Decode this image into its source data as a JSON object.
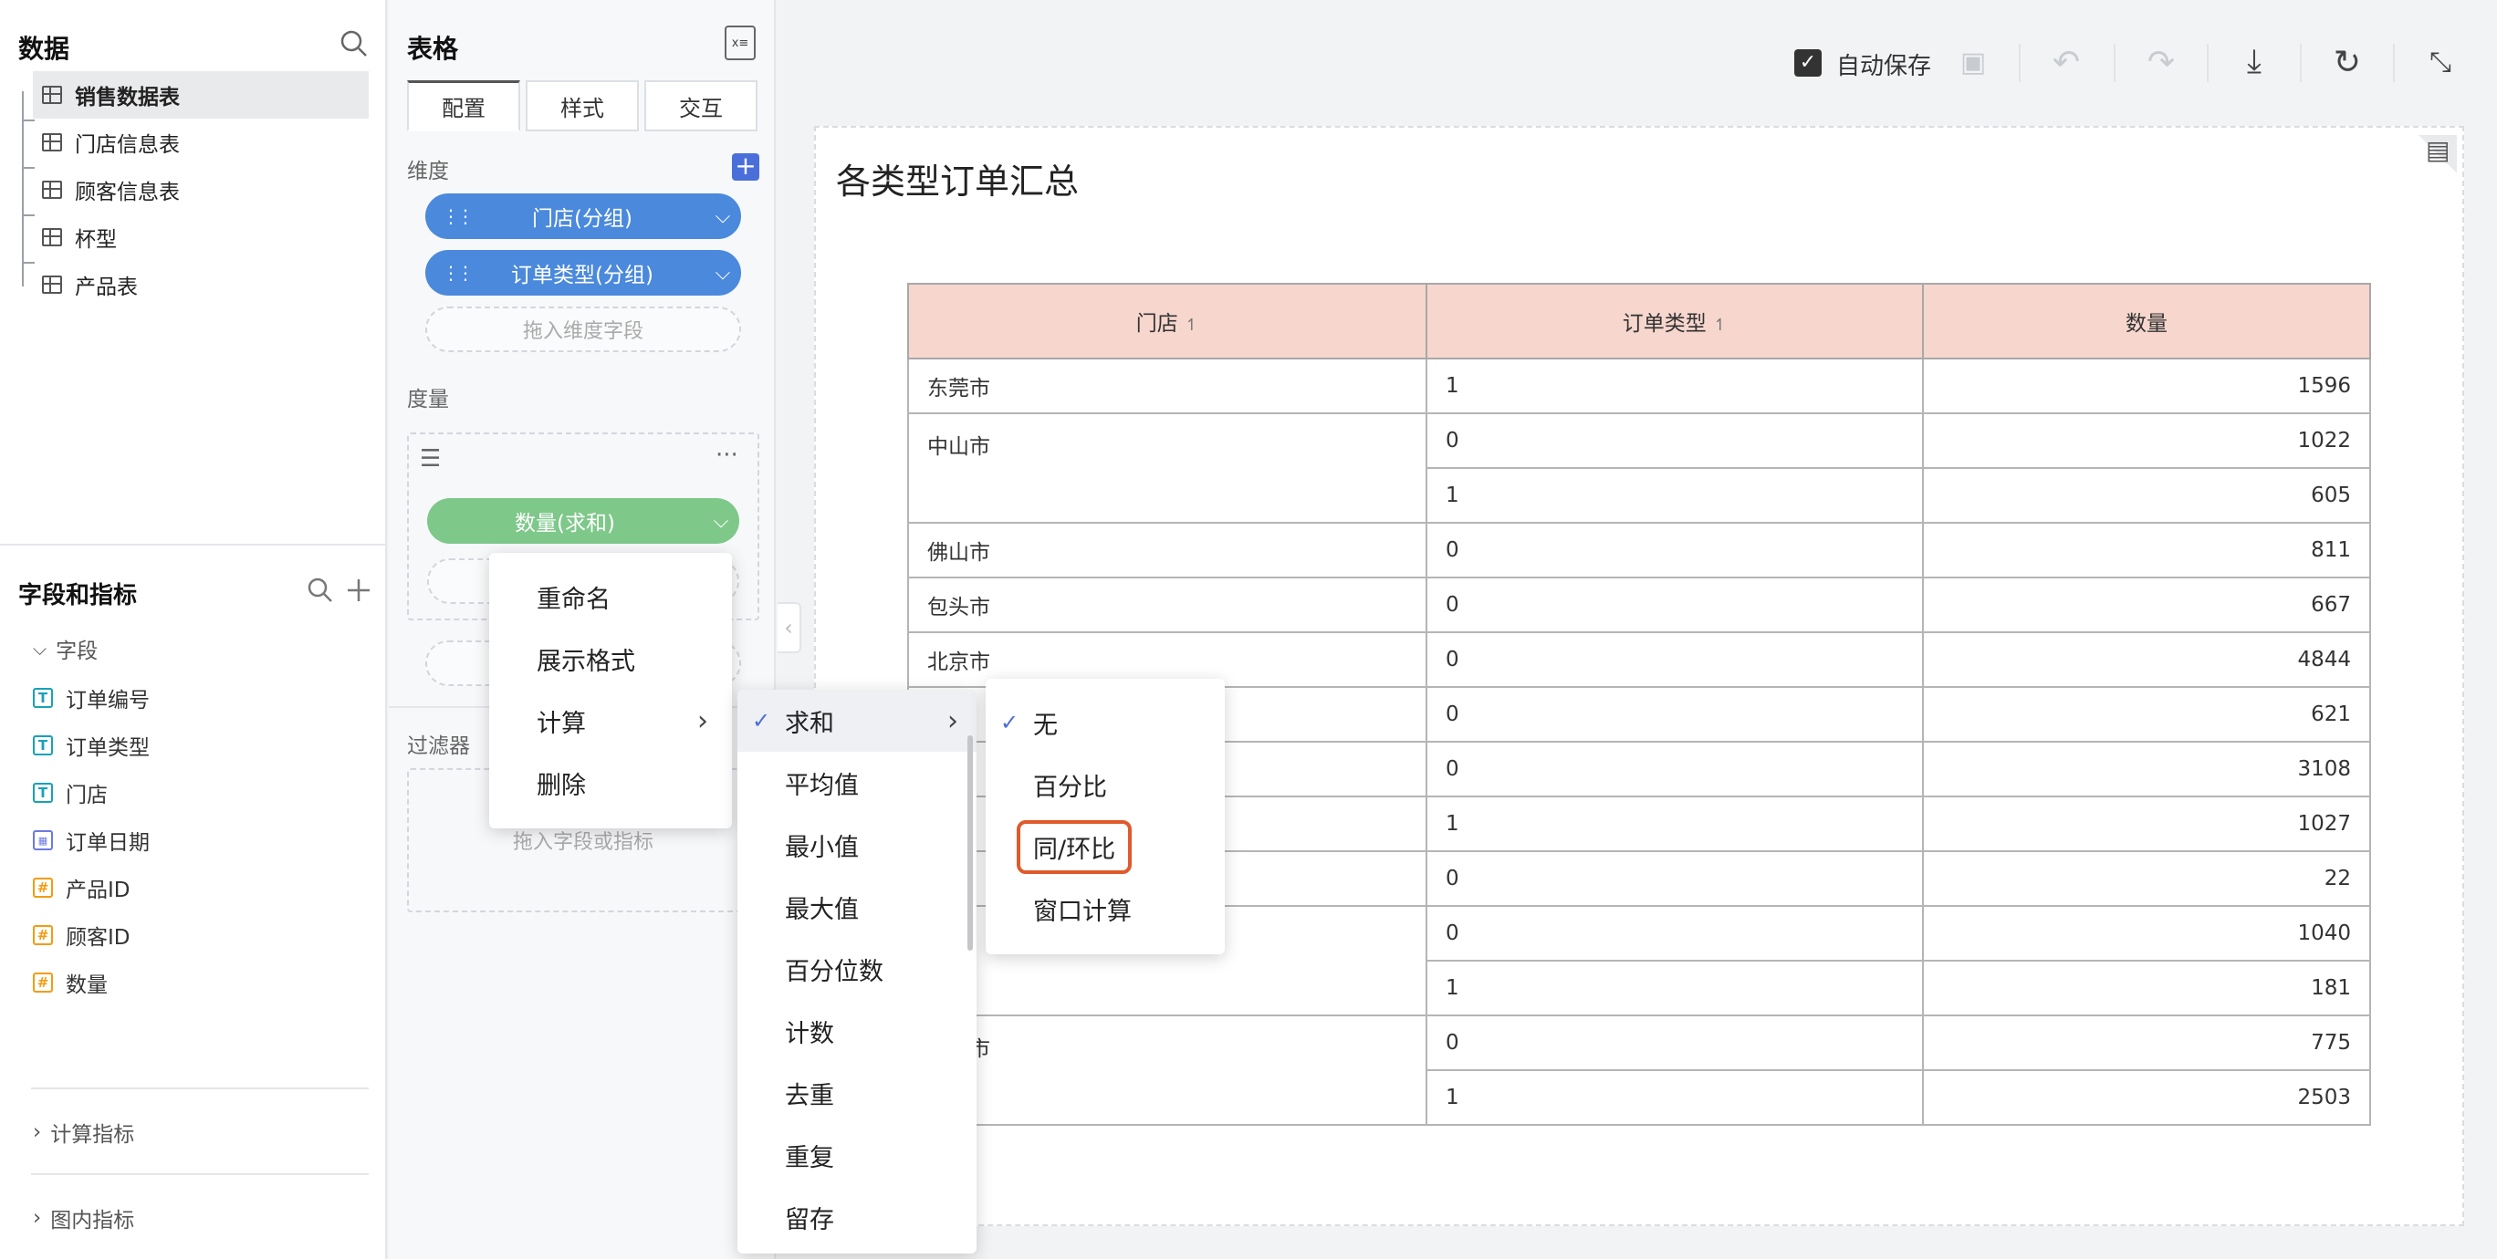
{
  "left_panel": {
    "title": "数据",
    "tables": [
      "销售数据表",
      "门店信息表",
      "顾客信息表",
      "杯型",
      "产品表"
    ],
    "fields_title": "字段和指标",
    "fields_group": "字段",
    "fields": [
      {
        "name": "订单编号",
        "type": "T"
      },
      {
        "name": "订单类型",
        "type": "T"
      },
      {
        "name": "门店",
        "type": "T"
      },
      {
        "name": "订单日期",
        "type": "D"
      },
      {
        "name": "产品ID",
        "type": "#"
      },
      {
        "name": "顾客ID",
        "type": "#"
      },
      {
        "name": "数量",
        "type": "#"
      }
    ],
    "calc_metrics": "计算指标",
    "inner_metrics": "图内指标"
  },
  "config_panel": {
    "title": "表格",
    "tabs": [
      "配置",
      "样式",
      "交互"
    ],
    "dimension_label": "维度",
    "dimension_pills": [
      "门店(分组)",
      "订单类型(分组)"
    ],
    "dimension_drop": "拖入维度字段",
    "measure_label": "度量",
    "measure_pill": "数量(求和)",
    "filter_label": "过滤器",
    "filter_drop": "拖入字段或指标"
  },
  "toolbar": {
    "autosave_label": "自动保存",
    "autosave_checked": true
  },
  "canvas": {
    "chart_title": "各类型订单汇总",
    "columns": [
      "门店",
      "订单类型",
      "数量"
    ],
    "rows": [
      {
        "store": "东莞市",
        "type": "1",
        "qty": "1596"
      },
      {
        "store": "中山市",
        "type": "0",
        "qty": "1022"
      },
      {
        "store": "",
        "type": "1",
        "qty": "605"
      },
      {
        "store": "佛山市",
        "type": "0",
        "qty": "811"
      },
      {
        "store": "包头市",
        "type": "0",
        "qty": "667"
      },
      {
        "store": "北京市",
        "type": "0",
        "qty": "4844"
      },
      {
        "store": "",
        "type": "0",
        "qty": "621"
      },
      {
        "store": "",
        "type": "0",
        "qty": "3108"
      },
      {
        "store": "",
        "type": "1",
        "qty": "1027"
      },
      {
        "store": "",
        "type": "0",
        "qty": "22"
      },
      {
        "store": "",
        "type": "0",
        "qty": "1040"
      },
      {
        "store": "",
        "type": "1",
        "qty": "181"
      },
      {
        "store": "浩特市",
        "type": "0",
        "qty": "775"
      },
      {
        "store": "",
        "type": "1",
        "qty": "2503"
      }
    ]
  },
  "context_menu": [
    "重命名",
    "展示格式",
    "计算",
    "删除"
  ],
  "calc_submenu": [
    "求和",
    "平均值",
    "最小值",
    "最大值",
    "百分位数",
    "计数",
    "去重",
    "重复",
    "留存"
  ],
  "advanced_submenu": [
    "无",
    "百分比",
    "同/环比",
    "窗口计算"
  ],
  "colors": {
    "pill_blue": "#4a89dc",
    "pill_green": "#7ec88a",
    "header_bg": "#f6d6cd",
    "highlight_border": "#e05a2b"
  }
}
